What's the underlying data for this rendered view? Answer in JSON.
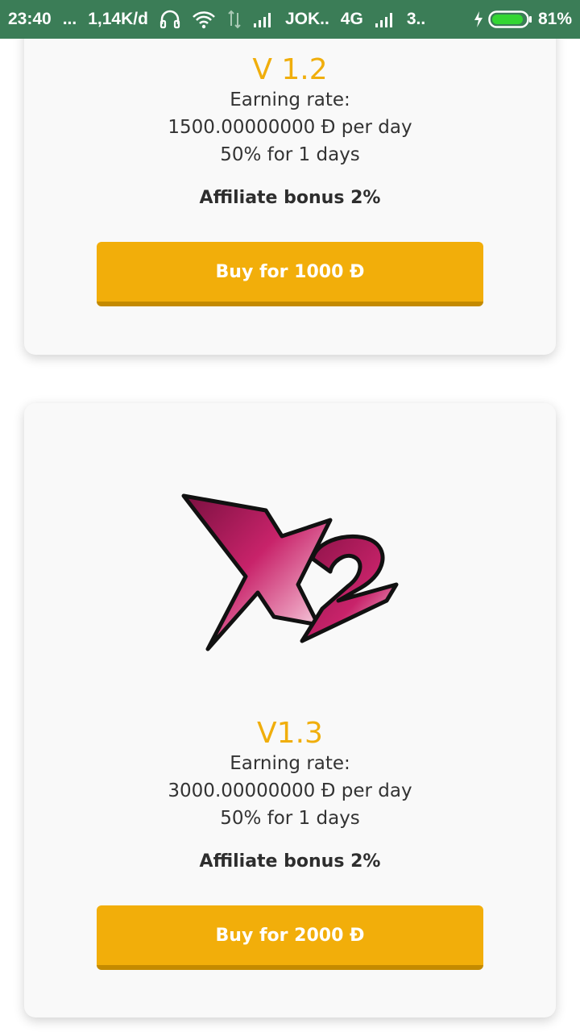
{
  "status_bar": {
    "time": "23:40",
    "dots": "...",
    "speed": "1,14K/d",
    "carrier": "JOK..",
    "network": "4G",
    "signal2": "3..",
    "battery": "81%"
  },
  "plans": [
    {
      "version": "V 1.2",
      "earning_label": "Earning rate:",
      "rate": "1500.00000000 Đ per day",
      "duration": "50% for 1 days",
      "bonus": "Affiliate bonus 2%",
      "button": "Buy for 1000 Đ"
    },
    {
      "version": "V1.3",
      "earning_label": "Earning rate:",
      "rate": "3000.00000000 Đ per day",
      "duration": "50% for 1 days",
      "bonus": "Affiliate bonus 2%",
      "button": "Buy for 2000 Đ",
      "logo_icon": "x2-logo"
    }
  ],
  "colors": {
    "status_bar": "#3b7d57",
    "accent": "#f2ae0a",
    "version_text": "#f0ae0c",
    "card_bg": "#f9f9f9"
  }
}
